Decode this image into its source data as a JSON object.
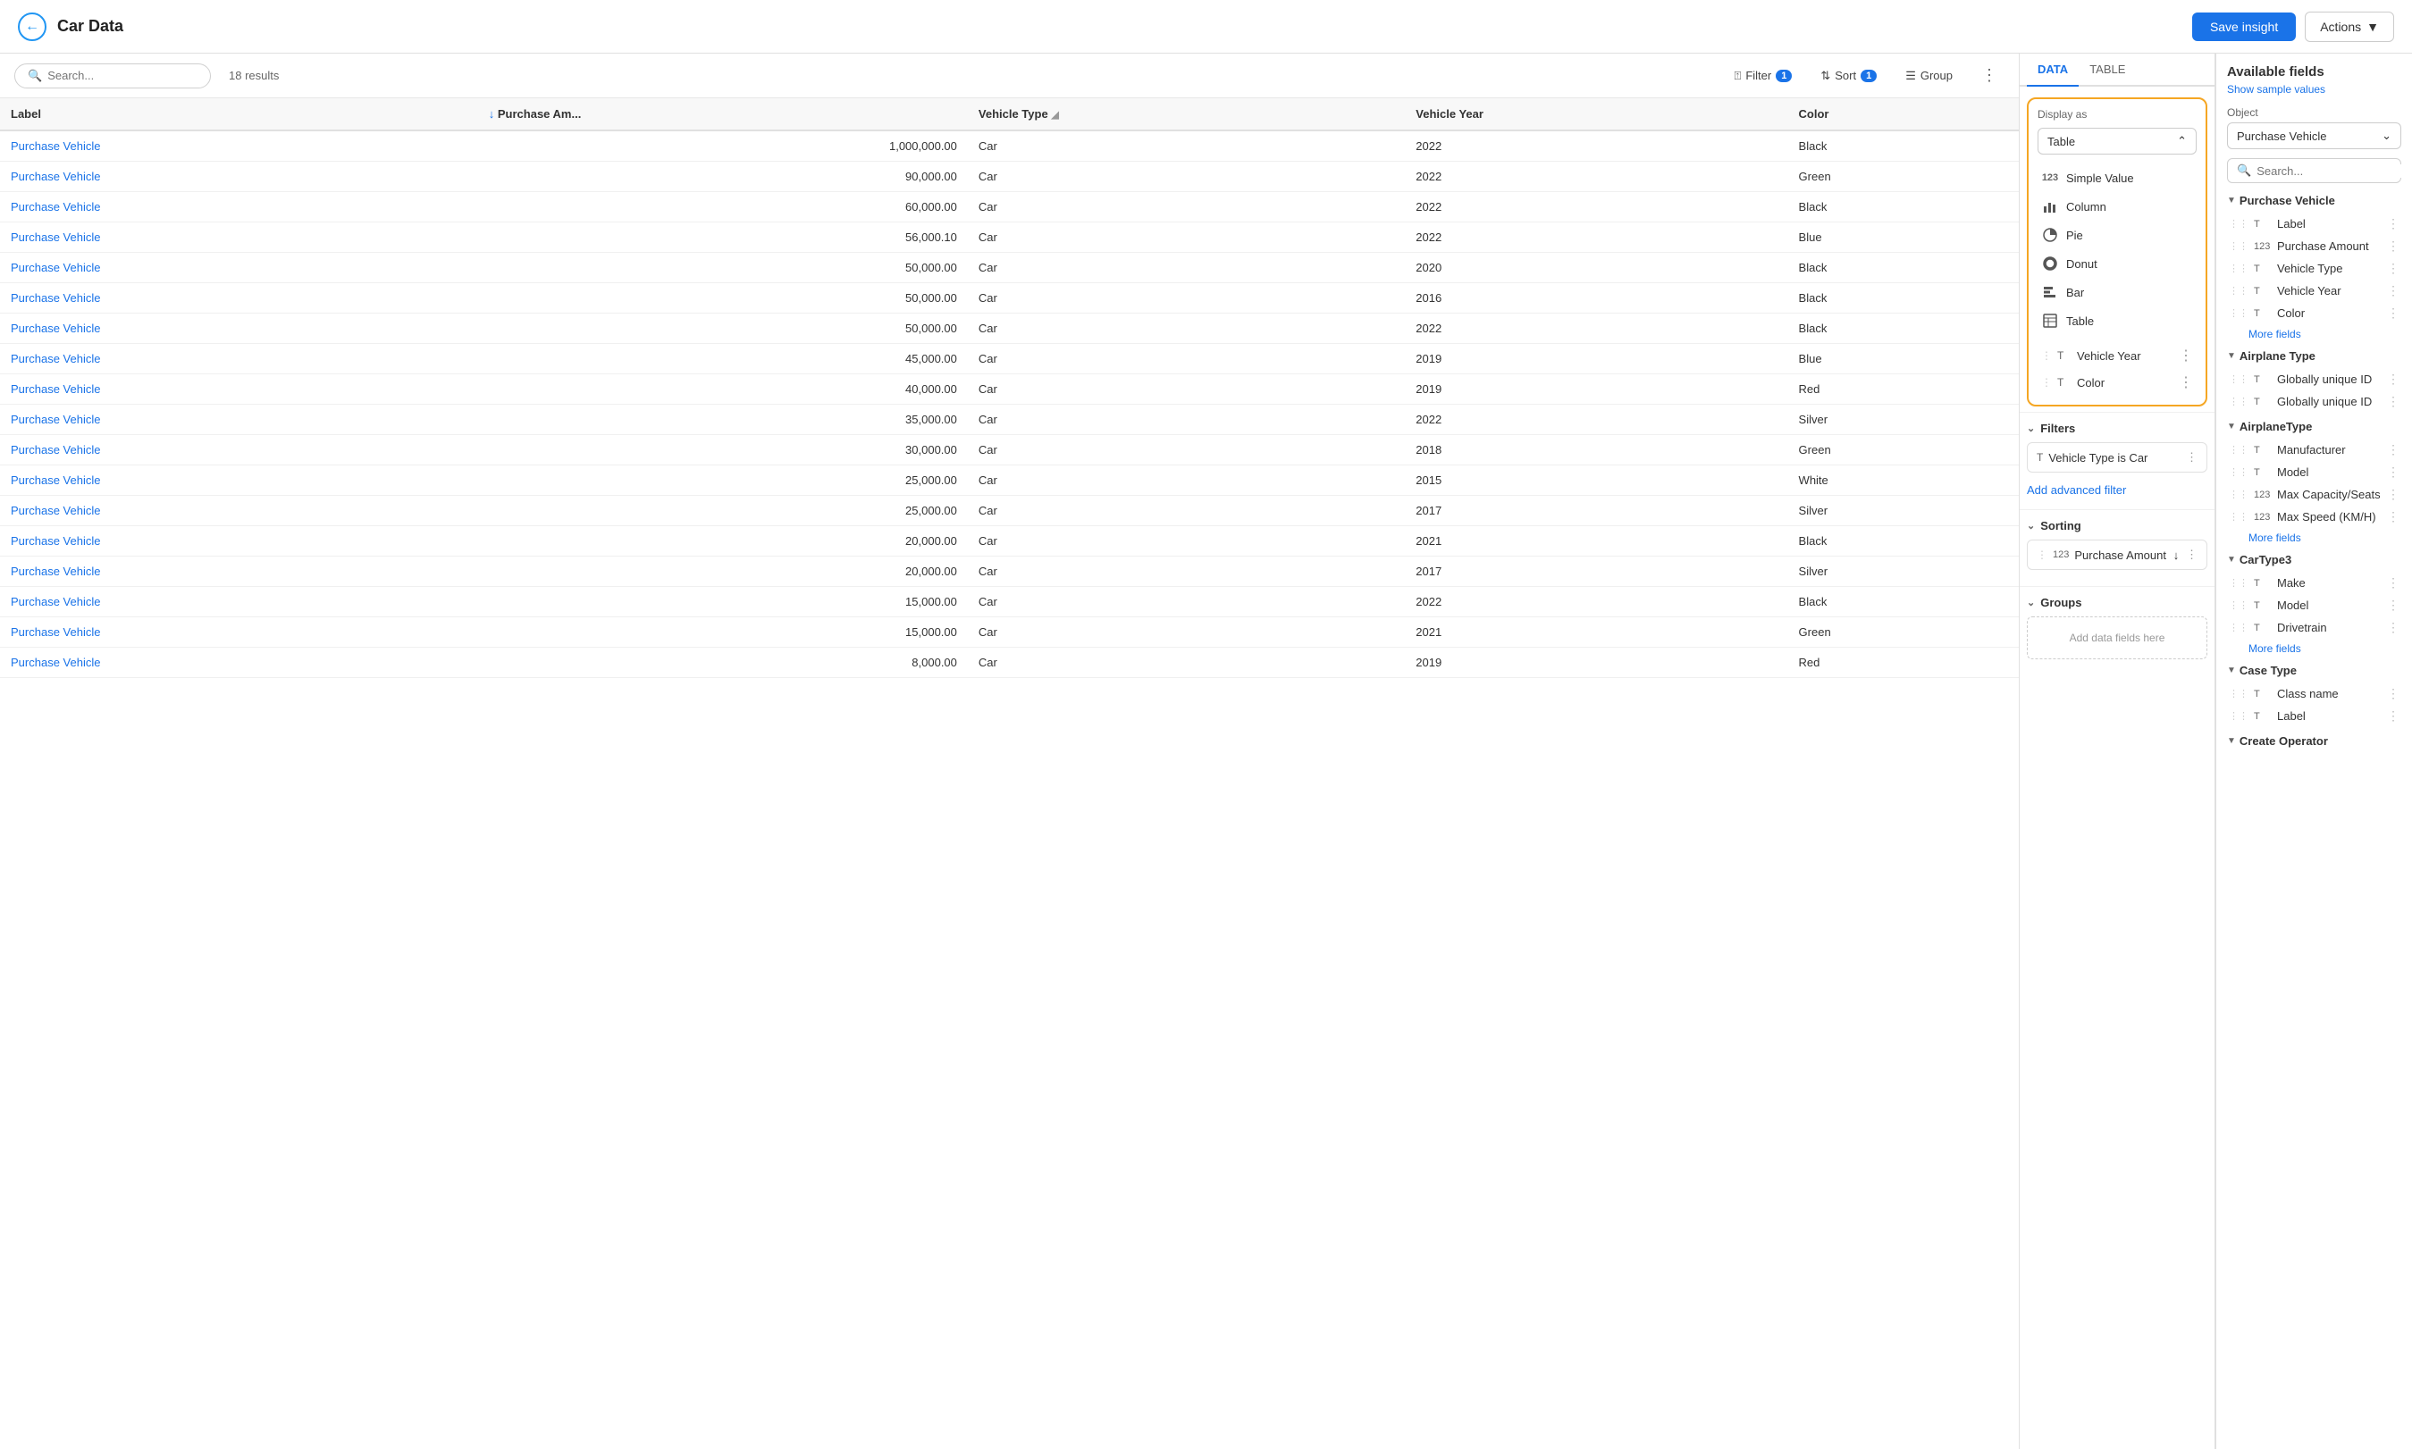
{
  "topbar": {
    "title": "Car Data",
    "save_label": "Save insight",
    "actions_label": "Actions",
    "back_icon": "‹"
  },
  "toolbar": {
    "search_placeholder": "Search...",
    "results_count": "18 results",
    "filter_label": "Filter",
    "filter_badge": "1",
    "sort_label": "Sort",
    "sort_badge": "1",
    "group_label": "Group"
  },
  "table": {
    "columns": [
      {
        "key": "label",
        "header": "Label",
        "sortable": false
      },
      {
        "key": "amount",
        "header": "Purchase Am...",
        "sortable": true
      },
      {
        "key": "vehicle_type",
        "header": "Vehicle Type",
        "sortable": false,
        "filterable": true
      },
      {
        "key": "vehicle_year",
        "header": "Vehicle Year",
        "sortable": false
      },
      {
        "key": "color",
        "header": "Color",
        "sortable": false
      }
    ],
    "rows": [
      {
        "label": "Purchase Vehicle",
        "amount": "1,000,000.00",
        "vehicle_type": "Car",
        "vehicle_year": "2022",
        "color": "Black"
      },
      {
        "label": "Purchase Vehicle",
        "amount": "90,000.00",
        "vehicle_type": "Car",
        "vehicle_year": "2022",
        "color": "Green"
      },
      {
        "label": "Purchase Vehicle",
        "amount": "60,000.00",
        "vehicle_type": "Car",
        "vehicle_year": "2022",
        "color": "Black"
      },
      {
        "label": "Purchase Vehicle",
        "amount": "56,000.10",
        "vehicle_type": "Car",
        "vehicle_year": "2022",
        "color": "Blue"
      },
      {
        "label": "Purchase Vehicle",
        "amount": "50,000.00",
        "vehicle_type": "Car",
        "vehicle_year": "2020",
        "color": "Black"
      },
      {
        "label": "Purchase Vehicle",
        "amount": "50,000.00",
        "vehicle_type": "Car",
        "vehicle_year": "2016",
        "color": "Black"
      },
      {
        "label": "Purchase Vehicle",
        "amount": "50,000.00",
        "vehicle_type": "Car",
        "vehicle_year": "2022",
        "color": "Black"
      },
      {
        "label": "Purchase Vehicle",
        "amount": "45,000.00",
        "vehicle_type": "Car",
        "vehicle_year": "2019",
        "color": "Blue"
      },
      {
        "label": "Purchase Vehicle",
        "amount": "40,000.00",
        "vehicle_type": "Car",
        "vehicle_year": "2019",
        "color": "Red"
      },
      {
        "label": "Purchase Vehicle",
        "amount": "35,000.00",
        "vehicle_type": "Car",
        "vehicle_year": "2022",
        "color": "Silver"
      },
      {
        "label": "Purchase Vehicle",
        "amount": "30,000.00",
        "vehicle_type": "Car",
        "vehicle_year": "2018",
        "color": "Green"
      },
      {
        "label": "Purchase Vehicle",
        "amount": "25,000.00",
        "vehicle_type": "Car",
        "vehicle_year": "2015",
        "color": "White"
      },
      {
        "label": "Purchase Vehicle",
        "amount": "25,000.00",
        "vehicle_type": "Car",
        "vehicle_year": "2017",
        "color": "Silver"
      },
      {
        "label": "Purchase Vehicle",
        "amount": "20,000.00",
        "vehicle_type": "Car",
        "vehicle_year": "2021",
        "color": "Black"
      },
      {
        "label": "Purchase Vehicle",
        "amount": "20,000.00",
        "vehicle_type": "Car",
        "vehicle_year": "2017",
        "color": "Silver"
      },
      {
        "label": "Purchase Vehicle",
        "amount": "15,000.00",
        "vehicle_type": "Car",
        "vehicle_year": "2022",
        "color": "Black"
      },
      {
        "label": "Purchase Vehicle",
        "amount": "15,000.00",
        "vehicle_type": "Car",
        "vehicle_year": "2021",
        "color": "Green"
      },
      {
        "label": "Purchase Vehicle",
        "amount": "8,000.00",
        "vehicle_type": "Car",
        "vehicle_year": "2019",
        "color": "Red"
      }
    ]
  },
  "middle_panel": {
    "tabs": [
      "DATA",
      "TABLE"
    ],
    "active_tab": "DATA",
    "display_as_label": "Display as",
    "display_selected": "Table",
    "display_options": [
      {
        "icon": "123",
        "label": "Simple Value"
      },
      {
        "icon": "bar_chart",
        "label": "Column"
      },
      {
        "icon": "pie",
        "label": "Pie"
      },
      {
        "icon": "donut",
        "label": "Donut"
      },
      {
        "icon": "bar",
        "label": "Bar"
      },
      {
        "icon": "table",
        "label": "Table",
        "active": true
      }
    ],
    "chart_columns": [
      {
        "type": "T",
        "name": "Vehicle Year"
      },
      {
        "type": "T",
        "name": "Color"
      }
    ],
    "filters_header": "Filters",
    "filters": [
      {
        "type": "T",
        "text": "Vehicle Type is Car"
      }
    ],
    "add_filter_label": "Add advanced filter",
    "sorting_header": "Sorting",
    "sorting_items": [
      {
        "type": "123",
        "name": "Purchase Amount",
        "direction": "desc"
      }
    ],
    "groups_header": "Groups",
    "groups_placeholder": "Add data fields here"
  },
  "right_panel": {
    "title": "Available fields",
    "show_sample_label": "Show sample values",
    "object_label": "Object",
    "object_value": "Purchase Vehicle",
    "search_placeholder": "Search...",
    "sections": [
      {
        "name": "Purchase Vehicle",
        "fields": [
          {
            "type": "T",
            "name": "Label"
          },
          {
            "type": "123",
            "name": "Purchase Amount"
          },
          {
            "type": "T",
            "name": "Vehicle Type"
          },
          {
            "type": "T",
            "name": "Vehicle Year"
          },
          {
            "type": "T",
            "name": "Color"
          }
        ],
        "more_fields": "More fields"
      },
      {
        "name": "Airplane Type",
        "fields": [
          {
            "type": "T",
            "name": "Globally unique ID"
          },
          {
            "type": "T",
            "name": "Globally unique ID"
          }
        ]
      },
      {
        "name": "AirplaneType",
        "fields": [
          {
            "type": "T",
            "name": "Manufacturer"
          },
          {
            "type": "T",
            "name": "Model"
          },
          {
            "type": "123",
            "name": "Max Capacity/Seats"
          },
          {
            "type": "123",
            "name": "Max Speed (KM/H)"
          }
        ],
        "more_fields": "More fields"
      },
      {
        "name": "CarType3",
        "fields": [
          {
            "type": "T",
            "name": "Make"
          },
          {
            "type": "T",
            "name": "Model"
          },
          {
            "type": "T",
            "name": "Drivetrain"
          }
        ],
        "more_fields": "More fields"
      },
      {
        "name": "Case Type",
        "fields": [
          {
            "type": "T",
            "name": "Class name"
          },
          {
            "type": "T",
            "name": "Label"
          }
        ]
      },
      {
        "name": "Create Operator",
        "fields": []
      }
    ]
  }
}
